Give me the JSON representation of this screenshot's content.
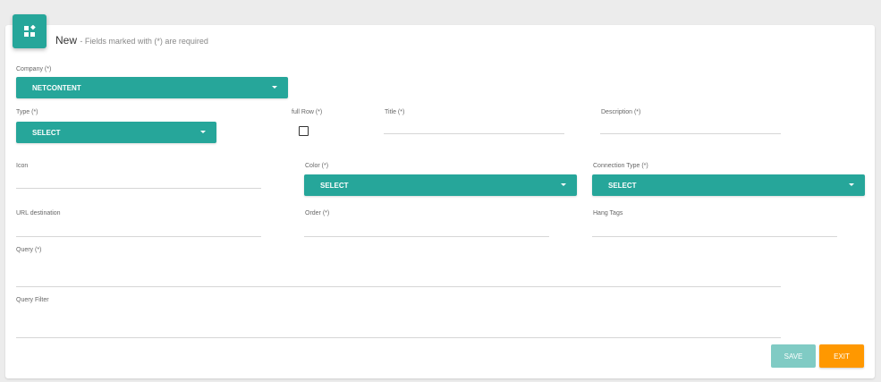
{
  "header": {
    "title": "New",
    "subtitle": "- Fields marked with (*) are required",
    "icon": "widgets-icon"
  },
  "fields": {
    "company": {
      "label": "Company (*)",
      "value": "NETCONTENT"
    },
    "type": {
      "label": "Type (*)",
      "value": "SELECT"
    },
    "full_row": {
      "label": "full Row (*)",
      "checked": false
    },
    "title": {
      "label": "Title (*)",
      "value": ""
    },
    "description": {
      "label": "Description (*)",
      "value": ""
    },
    "icon": {
      "label": "Icon",
      "value": ""
    },
    "color": {
      "label": "Color (*)",
      "value": "SELECT"
    },
    "connection_type": {
      "label": "Connection Type (*)",
      "value": "SELECT"
    },
    "url_destination": {
      "label": "URL destination",
      "value": ""
    },
    "order": {
      "label": "Order (*)",
      "value": ""
    },
    "hang_tags": {
      "label": "Hang Tags",
      "value": ""
    },
    "query": {
      "label": "Query (*)",
      "value": ""
    },
    "query_filter": {
      "label": "Query Filter",
      "value": ""
    }
  },
  "buttons": {
    "save": "SAVE",
    "exit": "EXIT"
  },
  "colors": {
    "primary": "#26a69a",
    "primary_disabled": "#80cbc4",
    "accent": "#ff9800"
  }
}
